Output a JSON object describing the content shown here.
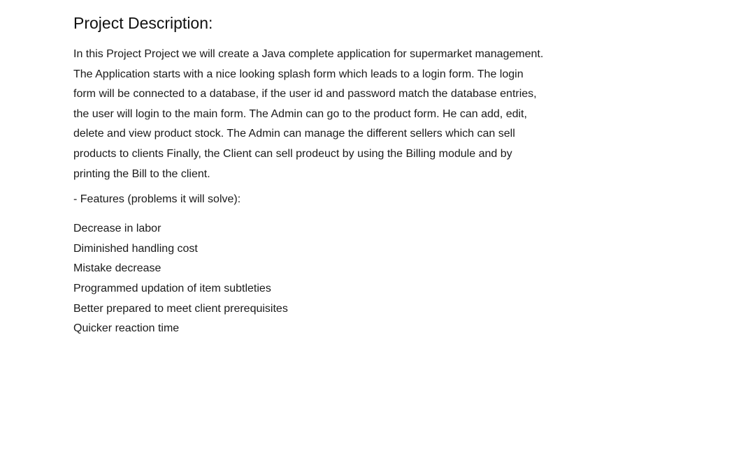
{
  "document": {
    "heading": "Project Description:",
    "description_lines": [
      "In this Project Project we will create a Java complete application for supermarket management.",
      "The Application starts with a nice looking splash form which leads to a login form. The login",
      "form will be connected to a database, if the user id and password match the database entries,",
      "the user will login to the main form. The Admin can go to the product form. He can add, edit,",
      "delete and view product stock. The Admin can manage the different sellers which can sell",
      "products to clients Finally, the Client can sell prodeuct by using the Billing module and by",
      "printing the Bill to the client."
    ],
    "features_title": "- Features (problems it will solve):",
    "features": [
      "Decrease in labor",
      "Diminished handling cost",
      "Mistake decrease",
      "Programmed updation of item subtleties",
      "Better prepared to meet client prerequisites",
      "Quicker reaction time"
    ]
  }
}
